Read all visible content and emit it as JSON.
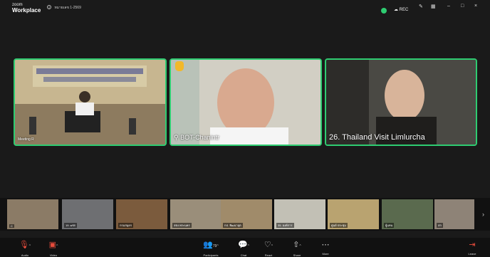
{
  "app": {
    "logo_line1": "zoom",
    "logo_line2": "Workplace",
    "meeting_title": "หมายเลข 1-2569"
  },
  "header": {
    "rec_label": "REC",
    "minimize": "–",
    "restore": "□",
    "close": "×"
  },
  "tiles": [
    {
      "name": "Meeting R"
    },
    {
      "name": "BOT-Chanintr"
    },
    {
      "name": "26. Thailand Visit Limlurcha"
    }
  ],
  "thumbnails": [
    {
      "name": "C"
    },
    {
      "name": "19. ບชก"
    },
    {
      "name": "กรมสมุดร"
    },
    {
      "name": "สตง.พระนคร"
    },
    {
      "name": "กป. ฟัฒนาอุต"
    },
    {
      "name": "35. องค์การ"
    },
    {
      "name": "ศูนย์ ประชุม"
    },
    {
      "name": "ผู้แทน"
    },
    {
      "name": "สก"
    }
  ],
  "toolbar": {
    "audio": "Audio",
    "video": "Video",
    "participants": "Participants",
    "participants_count": "79",
    "chat": "Chat",
    "react": "React",
    "share": "Share",
    "more": "More",
    "leave": "Leave"
  },
  "colors": {
    "active_speaker": "#2ecc71",
    "mic_muted": "#e74c3c",
    "leave": "#e74c3c",
    "raised_hand": "#f2b829"
  },
  "icons": [
    "info-icon",
    "record-icon",
    "pencil-icon",
    "grid-icon",
    "mic-muted-icon",
    "video-off-icon",
    "participants-icon",
    "chat-icon",
    "heart-icon",
    "share-icon",
    "more-icon",
    "leave-icon",
    "raised-hand-icon",
    "pin-icon"
  ]
}
